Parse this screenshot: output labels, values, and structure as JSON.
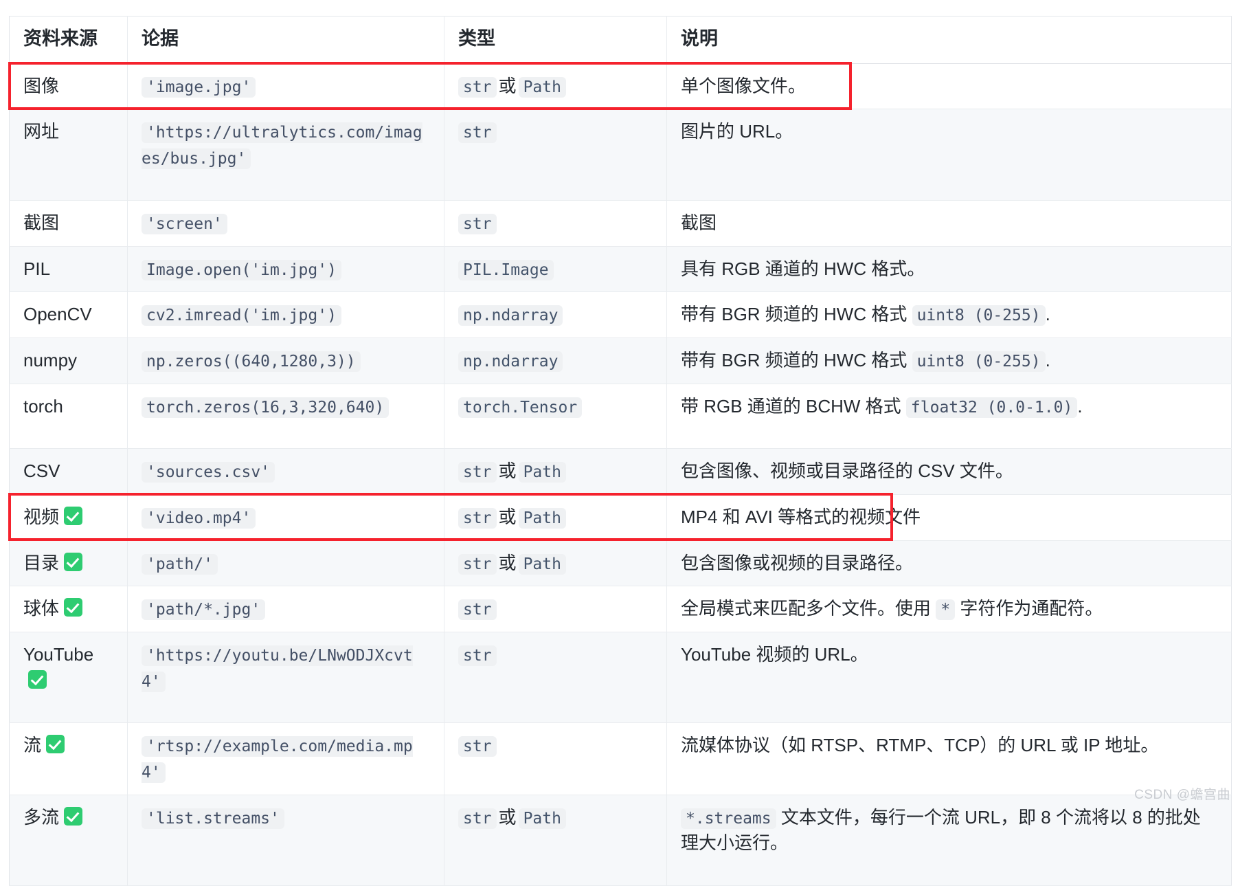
{
  "table": {
    "headers": [
      "资料来源",
      "论据",
      "类型",
      "说明"
    ],
    "rows": [
      {
        "source": "图像",
        "check": false,
        "arg": "'image.jpg'",
        "type_parts": [
          "str",
          "或",
          "Path"
        ],
        "desc_prefix": "单个图像文件。",
        "desc_code": "",
        "desc_suffix": ""
      },
      {
        "source": "网址",
        "check": false,
        "arg": "'https://ultralytics.com/images/bus.jpg'",
        "type_parts": [
          "str"
        ],
        "desc_prefix": "图片的 URL。",
        "desc_code": "",
        "desc_suffix": ""
      },
      {
        "source": "截图",
        "check": false,
        "arg": "'screen'",
        "type_parts": [
          "str"
        ],
        "desc_prefix": "截图",
        "desc_code": "",
        "desc_suffix": ""
      },
      {
        "source": "PIL",
        "check": false,
        "arg": "Image.open('im.jpg')",
        "type_parts": [
          "PIL.Image"
        ],
        "desc_prefix": "具有 RGB 通道的 HWC 格式。",
        "desc_code": "",
        "desc_suffix": ""
      },
      {
        "source": "OpenCV",
        "check": false,
        "arg": "cv2.imread('im.jpg')",
        "type_parts": [
          "np.ndarray"
        ],
        "desc_prefix": "带有 BGR 频道的 HWC 格式 ",
        "desc_code": "uint8 (0-255)",
        "desc_suffix": "."
      },
      {
        "source": "numpy",
        "check": false,
        "arg": "np.zeros((640,1280,3))",
        "type_parts": [
          "np.ndarray"
        ],
        "desc_prefix": "带有 BGR 频道的 HWC 格式 ",
        "desc_code": "uint8 (0-255)",
        "desc_suffix": "."
      },
      {
        "source": "torch",
        "check": false,
        "arg": "torch.zeros(16,3,320,640)",
        "type_parts": [
          "torch.Tensor"
        ],
        "desc_prefix": "带 RGB 通道的 BCHW 格式 ",
        "desc_code": "float32 (0.0-1.0)",
        "desc_suffix": "."
      },
      {
        "source": "CSV",
        "check": false,
        "arg": "'sources.csv'",
        "type_parts": [
          "str",
          "或",
          "Path"
        ],
        "desc_prefix": "包含图像、视频或目录路径的 CSV 文件。",
        "desc_code": "",
        "desc_suffix": ""
      },
      {
        "source": "视频",
        "check": true,
        "arg": "'video.mp4'",
        "type_parts": [
          "str",
          "或",
          "Path"
        ],
        "desc_prefix": "MP4 和 AVI 等格式的视频文件",
        "desc_code": "",
        "desc_suffix": ""
      },
      {
        "source": "目录",
        "check": true,
        "arg": "'path/'",
        "type_parts": [
          "str",
          "或",
          "Path"
        ],
        "desc_prefix": "包含图像或视频的目录路径。",
        "desc_code": "",
        "desc_suffix": ""
      },
      {
        "source": "球体",
        "check": true,
        "arg": "'path/*.jpg'",
        "type_parts": [
          "str"
        ],
        "desc_prefix": "全局模式来匹配多个文件。使用 ",
        "desc_code": "*",
        "desc_suffix": " 字符作为通配符。"
      },
      {
        "source": "YouTube",
        "check": true,
        "arg": "'https://youtu.be/LNwODJXcvt4'",
        "type_parts": [
          "str"
        ],
        "desc_prefix": "YouTube 视频的 URL。",
        "desc_code": "",
        "desc_suffix": ""
      },
      {
        "source": "流",
        "check": true,
        "arg": "'rtsp://example.com/media.mp4'",
        "type_parts": [
          "str"
        ],
        "desc_prefix": "流媒体协议（如 RTSP、RTMP、TCP）的 URL 或 IP 地址。",
        "desc_code": "",
        "desc_suffix": ""
      },
      {
        "source": "多流",
        "check": true,
        "arg": "'list.streams'",
        "type_parts": [
          "str",
          "或",
          "Path"
        ],
        "desc_prefix": "",
        "desc_code": "*.streams",
        "desc_suffix": " 文本文件，每行一个流 URL，即 8 个流将以 8 的批处理大小运行。"
      }
    ]
  },
  "annotations": {
    "highlight_color": "#f5222d",
    "check_color": "#2ecc71",
    "boxes": [
      {
        "name": "image-row-highlight"
      },
      {
        "name": "video-row-highlight"
      }
    ]
  },
  "watermark": {
    "text": "CSDN @蟾宫曲"
  }
}
